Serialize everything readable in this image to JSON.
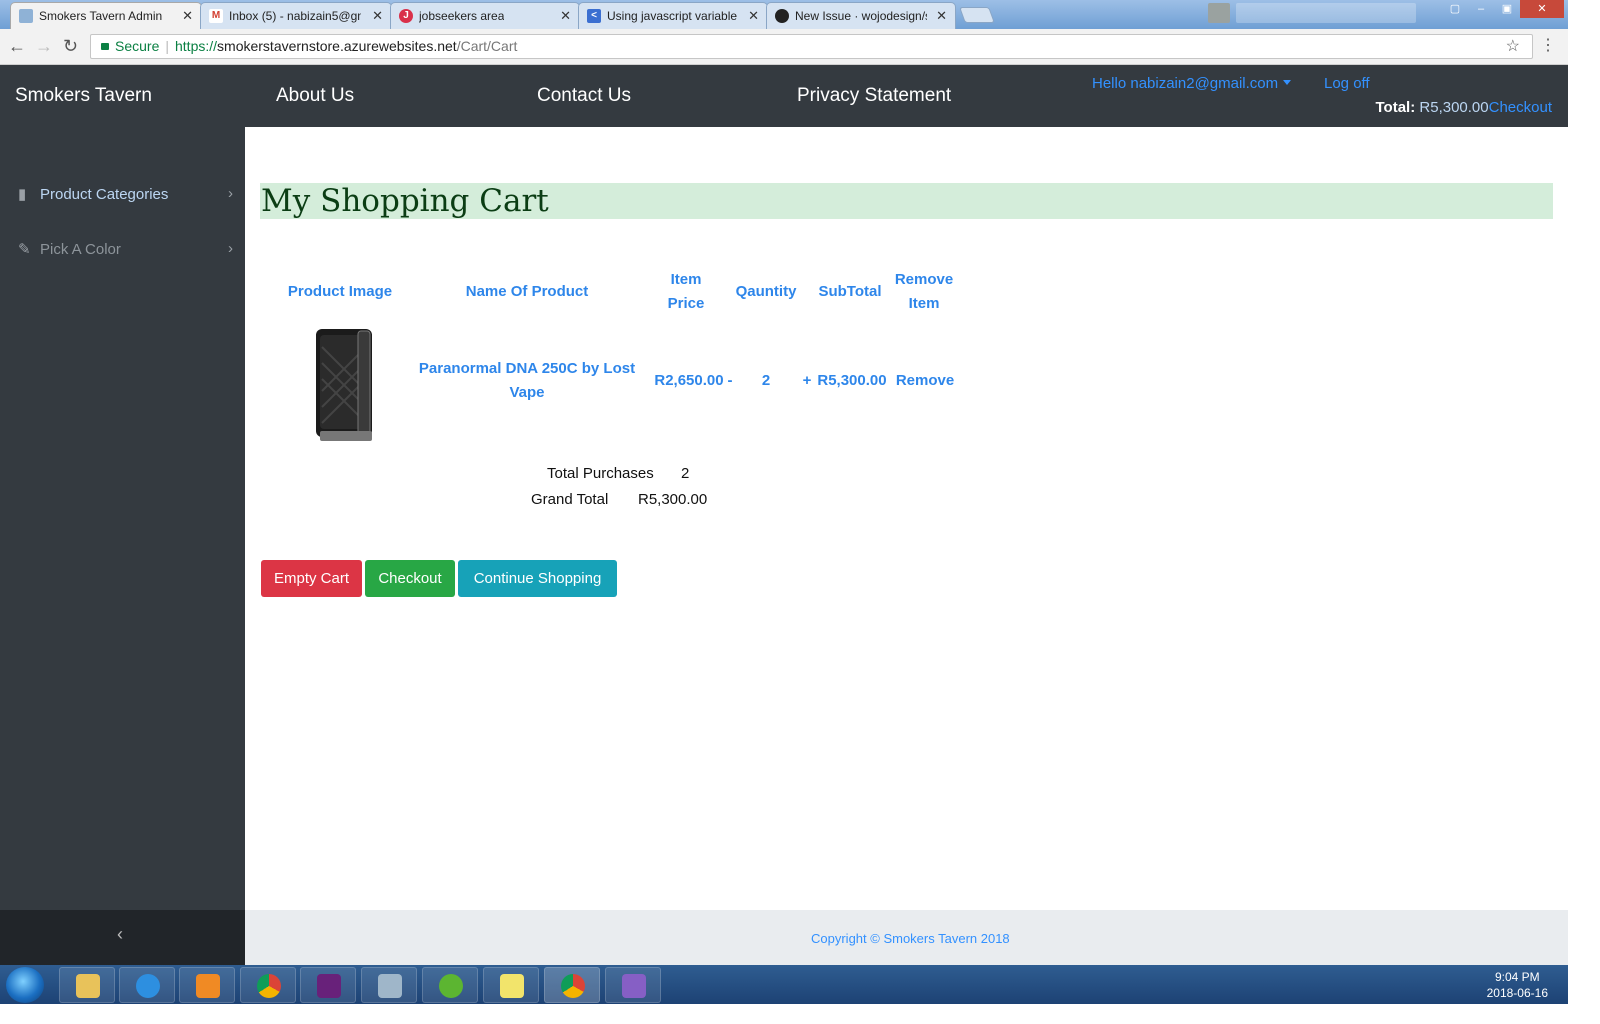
{
  "browser": {
    "tabs": [
      {
        "title": "Smokers Tavern Admin",
        "active": true,
        "favicon": "page-icon"
      },
      {
        "title": "Inbox (5) - nabizain5@gm",
        "active": false,
        "favicon": "gmail-icon"
      },
      {
        "title": "jobseekers area",
        "active": false,
        "favicon": "j-icon"
      },
      {
        "title": "Using javascript variable",
        "active": false,
        "favicon": "chevron-icon"
      },
      {
        "title": "New Issue · wojodesign/s",
        "active": false,
        "favicon": "github-icon"
      }
    ],
    "secure_label": "Secure",
    "url_scheme": "https://",
    "url_host": "smokerstavernstore.azurewebsites.net",
    "url_path": "/Cart/Cart"
  },
  "topbar": {
    "brand": "Smokers Tavern",
    "nav": [
      "About Us",
      "Contact Us",
      "Privacy Statement"
    ],
    "user_greeting": "Hello nabizain2@gmail.com",
    "logoff": "Log off",
    "total_label": "Total:",
    "total_value": "R5,300.00",
    "checkout_link": "Checkout"
  },
  "sidebar": {
    "items": [
      {
        "label": "Product Categories",
        "icon": "file-icon"
      },
      {
        "label": "Pick A Color",
        "icon": "brush-icon"
      }
    ],
    "collapse_icon": "chevron-left-icon"
  },
  "cart": {
    "title": "My Shopping Cart",
    "headers": {
      "image": "Product Image",
      "name": "Name Of Product",
      "price_l1": "Item",
      "price_l2": "Price",
      "quantity": "Qauntity",
      "subtotal": "SubTotal",
      "remove_l1": "Remove",
      "remove_l2": "Item"
    },
    "rows": [
      {
        "name_l1": "Paranormal DNA 250C by Lost",
        "name_l2": "Vape",
        "price": "R2,650.00",
        "decrement": "-",
        "quantity": "2",
        "increment": "+",
        "subtotal": "R5,300.00",
        "remove": "Remove"
      }
    ],
    "summary": {
      "total_purchases_label": "Total Purchases",
      "total_purchases_value": "2",
      "grand_total_label": "Grand Total",
      "grand_total_value": "R5,300.00"
    },
    "buttons": {
      "empty": "Empty Cart",
      "checkout": "Checkout",
      "continue": "Continue Shopping"
    }
  },
  "footer": {
    "copyright": "Copyright © Smokers Tavern 2018"
  },
  "taskbar": {
    "time": "9:04 PM",
    "date": "2018-06-16"
  },
  "colors": {
    "topbar_bg": "#343a40",
    "link_blue": "#2e86ea",
    "title_bg": "#d4edda",
    "danger": "#dc3545",
    "success": "#28a745",
    "info": "#17a2b8"
  }
}
